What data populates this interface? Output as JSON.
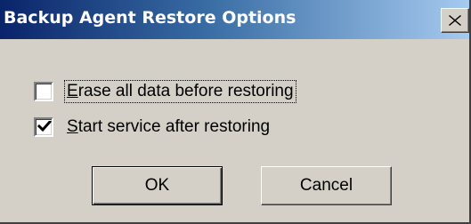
{
  "window": {
    "title": "Backup Agent Restore Options",
    "close_icon": "close-icon"
  },
  "options": {
    "erase": {
      "mnemonic": "E",
      "label_rest": "rase all data before restoring",
      "checked": false
    },
    "start_service": {
      "mnemonic": "S",
      "label_rest": "tart service after restoring",
      "checked": true
    }
  },
  "buttons": {
    "ok_label": "OK",
    "cancel_label": "Cancel"
  },
  "colors": {
    "title_gradient_start": "#0a246a",
    "title_gradient_end": "#a6caf0",
    "face": "#d4d0c8"
  }
}
